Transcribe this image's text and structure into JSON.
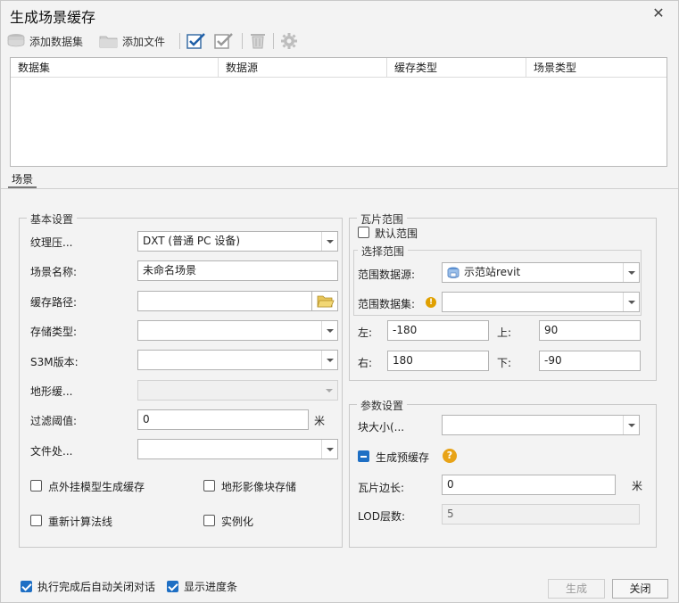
{
  "window": {
    "title": "生成场景缓存",
    "close_glyph": "✕"
  },
  "toolbar": {
    "add_dataset": "添加数据集",
    "add_file": "添加文件"
  },
  "grid": {
    "columns": [
      "数据集",
      "数据源",
      "缓存类型",
      "场景类型"
    ]
  },
  "tab": {
    "label": "场景"
  },
  "basic": {
    "title": "基本设置",
    "texture_label": "纹理压...",
    "texture_value": "DXT (普通 PC 设备)",
    "scene_name_label": "场景名称:",
    "scene_name_value": "未命名场景",
    "cache_path_label": "缓存路径:",
    "cache_path_value": "",
    "storage_type_label": "存储类型:",
    "storage_type_value": "",
    "s3m_version_label": "S3M版本:",
    "s3m_version_value": "",
    "terrain_label": "地形缓...",
    "terrain_value": "",
    "filter_label": "过滤阈值:",
    "filter_value": "0",
    "filter_unit": "米",
    "file_label": "文件处...",
    "file_value": "",
    "cb_point_model": "点外挂模型生成缓存",
    "cb_terrain_block": "地形影像块存储",
    "cb_recompute_normals": "重新计算法线",
    "cb_instancing": "实例化"
  },
  "tile_range": {
    "title": "瓦片范围",
    "default_range": "默认范围",
    "select_title": "选择范围",
    "datasource_label": "范围数据源:",
    "datasource_value": "示范站revit",
    "dataset_label": "范围数据集:",
    "dataset_value": "",
    "left_label": "左:",
    "left_value": "-180",
    "top_label": "上:",
    "top_value": "90",
    "right_label": "右:",
    "right_value": "180",
    "bottom_label": "下:",
    "bottom_value": "-90"
  },
  "params": {
    "title": "参数设置",
    "block_size_label": "块大小(...",
    "block_size_value": "",
    "pre_cache_label": "生成预缓存",
    "tile_edge_label": "瓦片边长:",
    "tile_edge_value": "0",
    "tile_edge_unit": "米",
    "lod_label": "LOD层数:",
    "lod_value": "5"
  },
  "footer": {
    "auto_close": "执行完成后自动关闭对话",
    "show_progress": "显示进度条",
    "generate": "生成",
    "close": "关闭"
  },
  "icons": {
    "help_glyph": "?",
    "warn_glyph": "!"
  }
}
